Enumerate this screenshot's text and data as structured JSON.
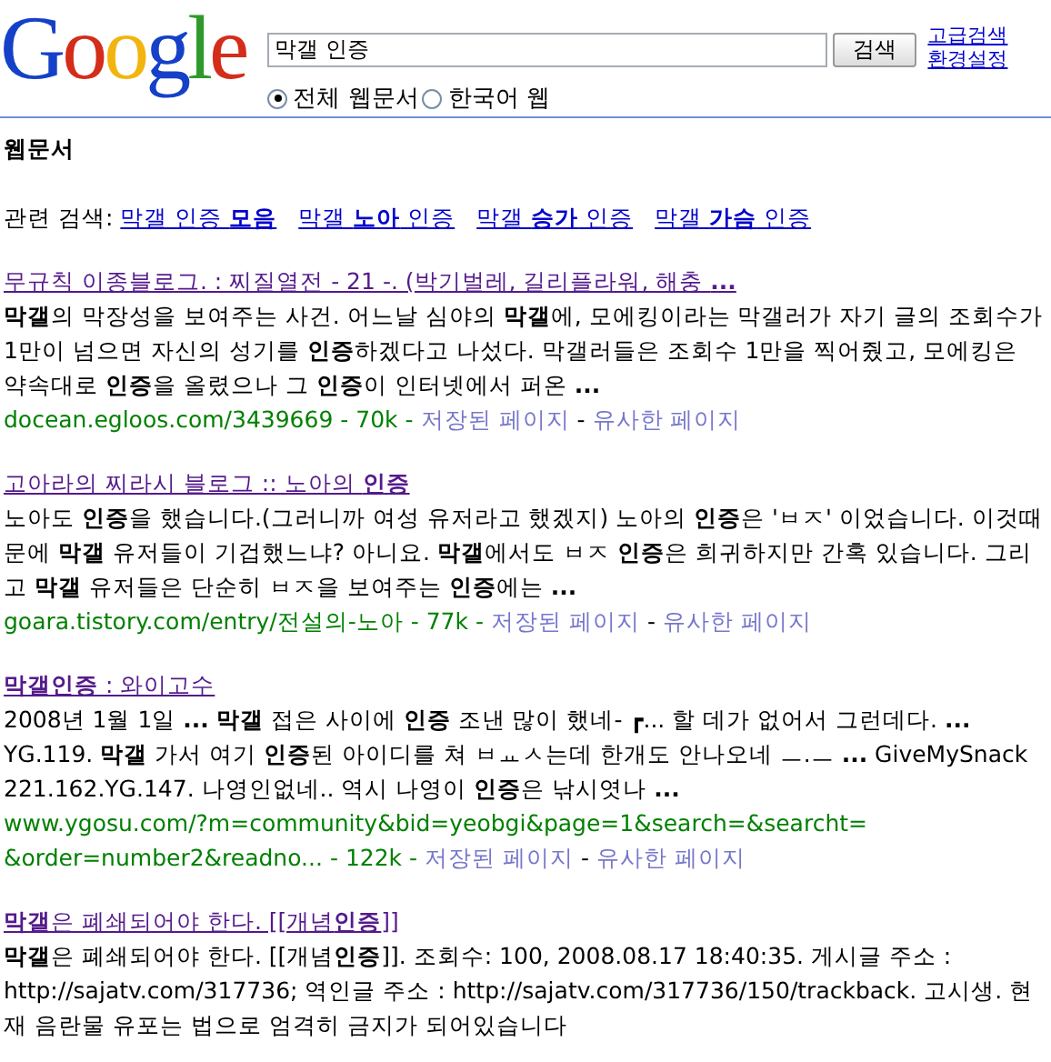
{
  "header": {
    "logo": "Google",
    "query": "막갤 인증",
    "search_button": "검색",
    "links": [
      "고급검색",
      "환경설정"
    ],
    "scopes": [
      {
        "label": "전체 웹문서",
        "selected": true
      },
      {
        "label": "한국어 웹",
        "selected": false
      }
    ]
  },
  "section_title": "웹문서",
  "related": {
    "label": "관련 검색:",
    "items": [
      "막갤 인증 **모음**",
      "막갤 **노아** 인증",
      "막갤 **승가** 인증",
      "막갤 **가슴** 인증"
    ]
  },
  "separator": "-",
  "results": [
    {
      "title": "무규칙 이종블로그. : 찌질열전 - 21 -. (박기벌레, 길리플라워, 해충 **...**",
      "snippet": "**막갤**의 막장성을 보여주는 사건. 어느날 심야의 **막갤**에, 모에킹이라는 막갤러가 자기 글의 조회수가 1만이 넘으면 자신의 성기를 **인증**하겠다고 나섰다. 막갤러들은 조회수 1만을 찍어줬고, 모에킹은 약속대로 **인증**을 올렸으나 그 **인증**이 인터넷에서 퍼온 **...**",
      "url": "docean.egloos.com/3439669",
      "size": "70k",
      "links": [
        "저장된 페이지",
        "유사한 페이지"
      ]
    },
    {
      "title": "고아라의 찌라시 블로그 :: 노아의 **인증**",
      "snippet": "노아도 **인증**을 했습니다.(그러니까 여성 유저라고 했겠지) 노아의 **인증**은 'ㅂㅈ' 이었습니다. 이것때문에 **막갤** 유저들이 기겁했느냐? 아니요. **막갤**에서도 ㅂㅈ **인증**은 희귀하지만 간혹 있습니다. 그리고 **막갤** 유저들은 단순히 ㅂㅈ을 보여주는 **인증**에는 **...**",
      "url": "goara.tistory.com/entry/전설의-노아",
      "size": "77k",
      "links": [
        "저장된 페이지",
        "유사한 페이지"
      ]
    },
    {
      "title": "**막갤인증** : 와이고수",
      "snippet": "2008년 1월 1일 **...** **막갤** 접은 사이에 **인증** 조낸 많이 했네- ┏... 할 데가 없어서 그런데다. **...** YG.119. **막갤** 가서 여기 **인증**된 아이디를 쳐   ㅂㅛㅅ는데 한개도 안나오네 ㅡ.ㅡ **...** GiveMySnack 221.162.YG.147. 나영인없네.. 역시 나영이 **인증**은 낚시엿나 **...**",
      "url": [
        "www.ygosu.com/?m=community&bid=yeobgi&page=1&search=&searcht=",
        "&order=number2&readno..."
      ],
      "size": "122k",
      "links": [
        "저장된 페이지",
        "유사한 페이지"
      ]
    },
    {
      "title": "**막갤**은 폐쇄되어야 한다. [[개념**인증**]]",
      "snippet": "**막갤**은 폐쇄되어야 한다. [[개념**인증**]]. 조회수: 100, 2008.08.17 18:40:35. 게시글 주소 : http://sajatv.com/317736; 역인글 주소 : http://sajatv.com/317736/150/trackback. 고시생. 현재 음란물 유포는 법으로 엄격히 금지가 되어있습니다"
    }
  ]
}
